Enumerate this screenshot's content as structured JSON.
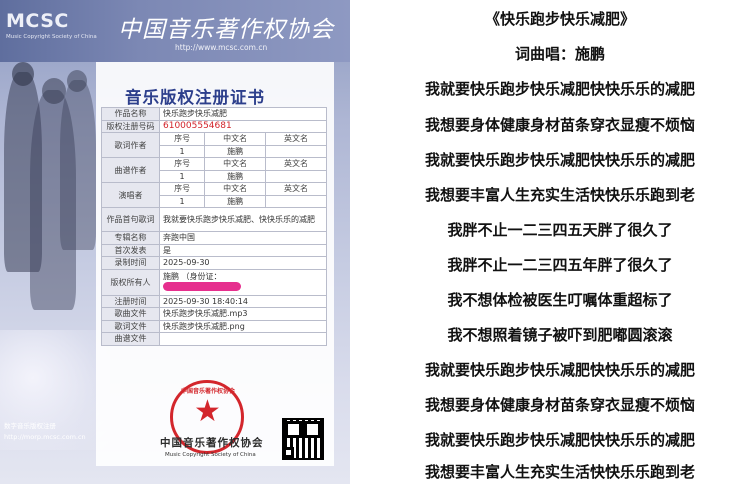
{
  "certificate": {
    "logo": "MCSC",
    "logo_sub": "Music Copyright Society of China",
    "header_calligraphy": "中国音乐著作权协会",
    "header_url": "http://www.mcsc.com.cn",
    "title": "音乐版权注册证书",
    "rows": {
      "work_name_label": "作品名称",
      "work_name": "快乐跑步快乐减肥",
      "reg_no_label": "版权注册号码",
      "reg_no": "610005554681",
      "lyricist_label": "歌词作者",
      "composer_label": "曲谱作者",
      "performer_label": "演唱者",
      "col_no": "序号",
      "col_cn": "中文名",
      "col_en": "英文名",
      "person_no": "1",
      "person_name": "施鹏",
      "first_line_label": "作品首句歌词",
      "first_line": "我就要快乐跑步快乐减肥、快快乐乐的减肥",
      "album_label": "专辑名称",
      "album": "奔跑中国",
      "release_label": "首次发表",
      "release": "是",
      "record_time_label": "录制时间",
      "record_time": "2025-09-30",
      "owner_label": "版权所有人",
      "owner_name": "施鹏",
      "owner_id": "（身份证：",
      "reg_time_label": "注册时间",
      "reg_time": "2025-09-30 18:40:14",
      "song_file_label": "歌曲文件",
      "song_file": "快乐跑步快乐减肥.mp3",
      "lyric_file_label": "歌词文件",
      "lyric_file": "快乐跑步快乐减肥.png",
      "score_file_label": "曲谱文件",
      "score_file": ""
    },
    "left_footer_1": "数字音乐版权注册",
    "left_footer_2": "http://morp.mcsc.com.cn",
    "seal_text": "中国音乐著作权协会",
    "assoc_cn": "中国音乐著作权协会",
    "assoc_en": "Music Copyright Society of China",
    "colors": {
      "title_blue": "#2d3f8c",
      "seal_red": "#d3262c",
      "reg_no_red": "#d2232a"
    }
  },
  "lyrics": {
    "title": "《快乐跑步快乐减肥》",
    "credit": "词曲唱：施鹏",
    "lines": [
      "我就要快乐跑步快乐减肥快快乐乐的减肥",
      "我想要身体健康身材苗条穿衣显瘦不烦恼",
      "我就要快乐跑步快乐减肥快快乐乐的减肥",
      "我想要丰富人生充实生活快快乐乐跑到老",
      "我胖不止一二三四五天胖了很久了",
      "我胖不止一二三四五年胖了很久了",
      "我不想体检被医生叮嘱体重超标了",
      "我不想照着镜子被吓到肥嘟圆滚滚",
      "我就要快乐跑步快乐减肥快快乐乐的减肥",
      "我想要身体健康身材苗条穿衣显瘦不烦恼",
      "我就要快乐跑步快乐减肥快快乐乐的减肥",
      "我想要丰富人生充实生活快快乐乐跑到老"
    ]
  }
}
